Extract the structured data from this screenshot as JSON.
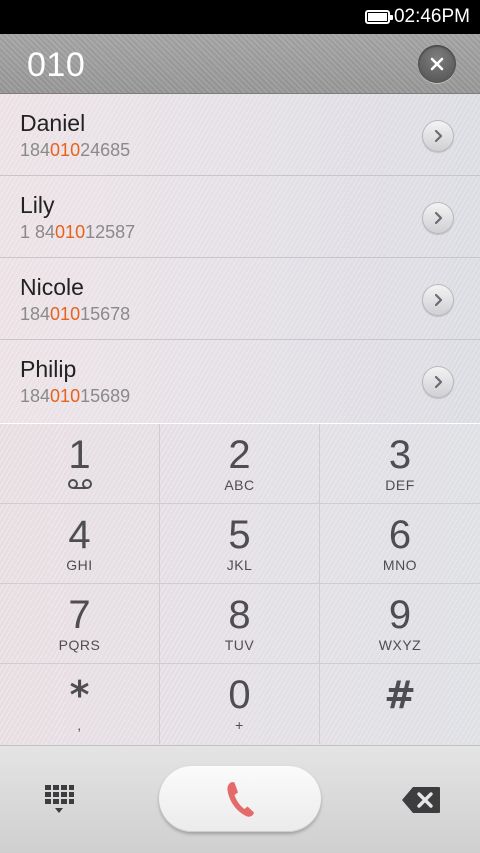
{
  "status_bar": {
    "time": "02:46PM",
    "battery_icon": "battery-icon"
  },
  "input": {
    "dialed": "010",
    "clear_icon": "close-icon"
  },
  "contacts": [
    {
      "name": "Daniel",
      "number_pre": "184",
      "number_match": "010",
      "number_post": "24685"
    },
    {
      "name": "Lily",
      "number_pre": "1 84",
      "number_match": "010",
      "number_post": "12587"
    },
    {
      "name": "Nicole",
      "number_pre": "184",
      "number_match": "010",
      "number_post": "15678"
    },
    {
      "name": "Philip",
      "number_pre": "184",
      "number_match": "010",
      "number_post": "15689"
    }
  ],
  "keypad": {
    "keys": [
      {
        "digit": "1",
        "letters": ""
      },
      {
        "digit": "2",
        "letters": "ABC"
      },
      {
        "digit": "3",
        "letters": "DEF"
      },
      {
        "digit": "4",
        "letters": "GHI"
      },
      {
        "digit": "5",
        "letters": "JKL"
      },
      {
        "digit": "6",
        "letters": "MNO"
      },
      {
        "digit": "7",
        "letters": "PQRS"
      },
      {
        "digit": "8",
        "letters": "TUV"
      },
      {
        "digit": "9",
        "letters": "WXYZ"
      },
      {
        "digit": "*",
        "letters": ","
      },
      {
        "digit": "0",
        "letters": "+"
      },
      {
        "digit": "#",
        "letters": ""
      }
    ],
    "voicemail_icon": "voicemail-icon"
  },
  "actions": {
    "dialpad_icon": "dialpad-icon",
    "call_icon": "phone-icon",
    "backspace_icon": "backspace-icon"
  },
  "colors": {
    "match_highlight": "#e8621c",
    "call_icon": "#e56a6a"
  }
}
